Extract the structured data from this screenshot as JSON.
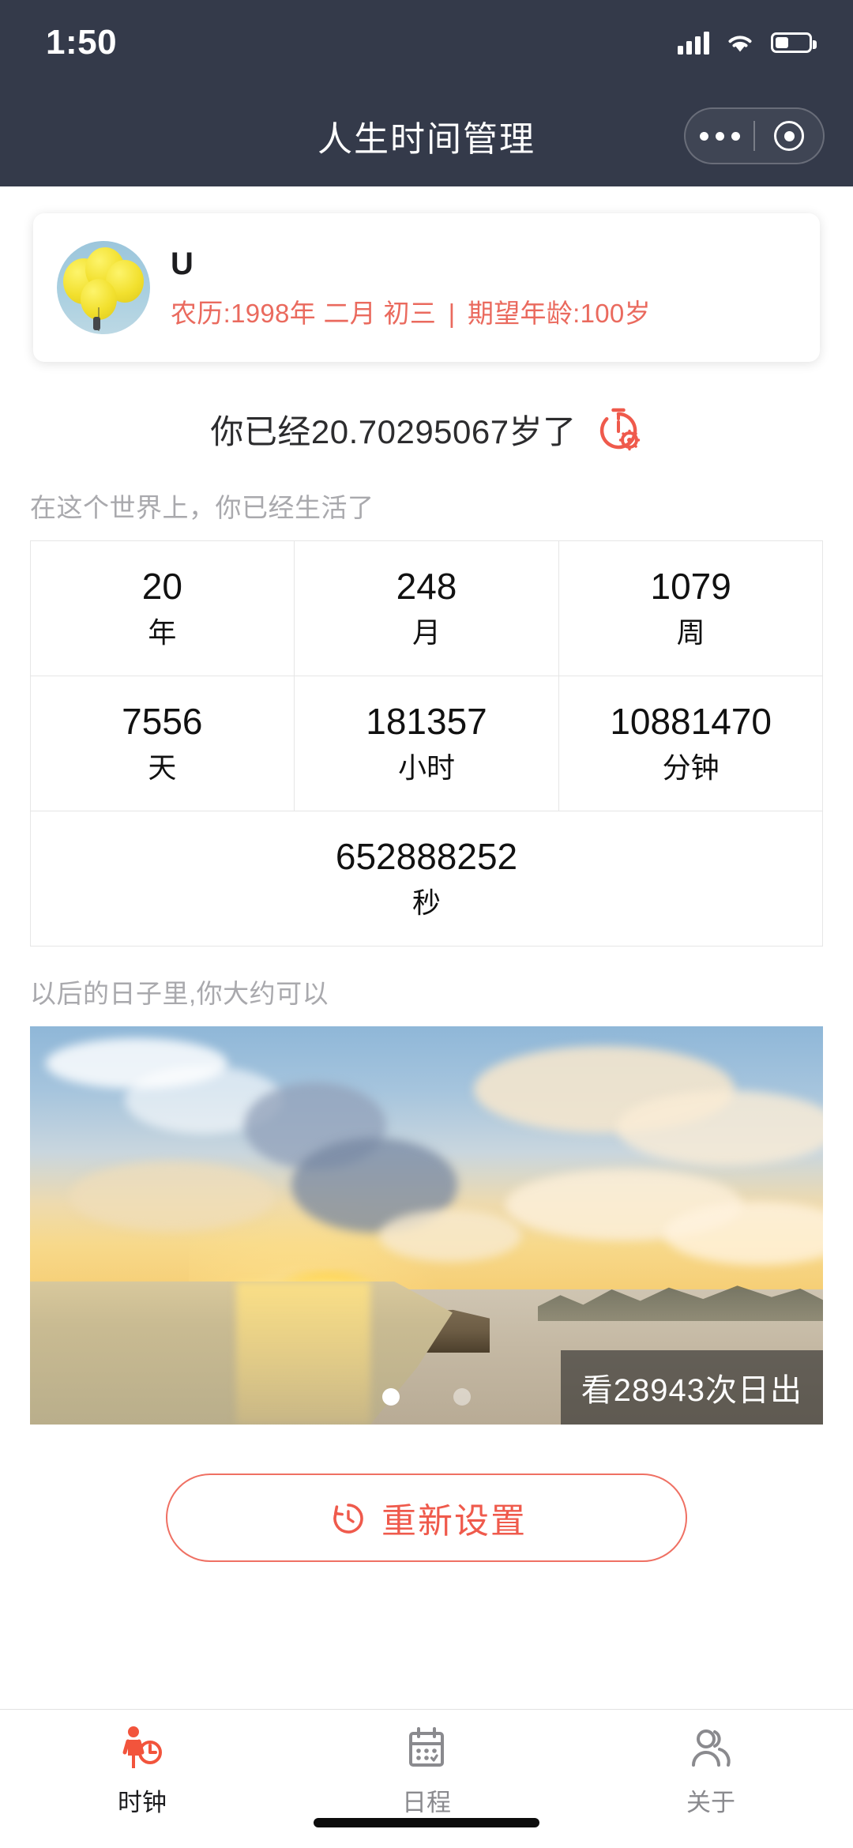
{
  "status_bar": {
    "time": "1:50",
    "signal_icon": "signal-bars-icon",
    "wifi_icon": "wifi-icon",
    "battery_icon": "battery-icon"
  },
  "nav": {
    "title": "人生时间管理",
    "capsule_more_icon": "more-dots-icon",
    "capsule_target_icon": "target-circle-icon"
  },
  "profile": {
    "avatar_icon": "balloons-avatar",
    "name": "U",
    "lunar_label": "农历:1998年 二月 初三",
    "separator": "|",
    "expected_age_label": "期望年龄:100岁"
  },
  "age_headline": {
    "text": "你已经20.70295067岁了",
    "age_value": "20.70295067",
    "settings_icon": "stopwatch-gear-icon"
  },
  "lived": {
    "caption": "在这个世界上，你已经生活了",
    "cells": [
      {
        "value": "20",
        "unit": "年"
      },
      {
        "value": "248",
        "unit": "月"
      },
      {
        "value": "1079",
        "unit": "周"
      },
      {
        "value": "7556",
        "unit": "天"
      },
      {
        "value": "181357",
        "unit": "小时"
      },
      {
        "value": "10881470",
        "unit": "分钟"
      },
      {
        "value": "652888252",
        "unit": "秒"
      }
    ]
  },
  "future": {
    "caption": "以后的日子里,你大约可以",
    "photo_name": "sunrise-beach-photo",
    "photo_caption": "看28943次日出",
    "carousel": {
      "count": 2,
      "active_index": 0
    }
  },
  "reset_button": {
    "label": "重新设置",
    "icon": "reset-clock-icon",
    "color": "#ef5a4c"
  },
  "tabbar": {
    "items": [
      {
        "label": "时钟",
        "icon": "person-clock-icon",
        "active": true
      },
      {
        "label": "日程",
        "icon": "calendar-icon",
        "active": false
      },
      {
        "label": "关于",
        "icon": "people-icon",
        "active": false
      }
    ]
  },
  "colors": {
    "nav_bg": "#343a4a",
    "accent_red": "#ef5a4c",
    "meta_red": "#ea6a5e",
    "muted_gray": "#a9a9ad"
  }
}
